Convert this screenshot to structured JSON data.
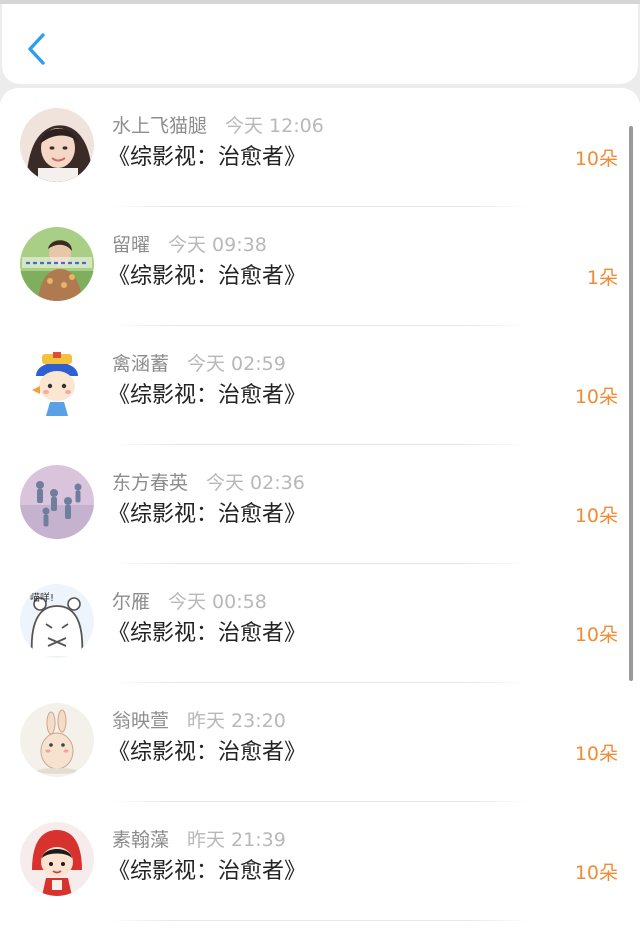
{
  "navbar": {
    "back_icon": "chevron-left-icon",
    "accent_color": "#2d9df0"
  },
  "list": {
    "count_color": "#f08c36",
    "items": [
      {
        "name": "水上飞猫腿",
        "time": "今天 12:06",
        "title": "《综影视：治愈者》",
        "count": "10朵",
        "avatar": "photo-woman-avatar"
      },
      {
        "name": "留曜",
        "time": "今天 09:38",
        "title": "《综影视：治愈者》",
        "count": "1朵",
        "avatar": "photo-man-avatar"
      },
      {
        "name": "禽涵蓄",
        "time": "今天 02:59",
        "title": "《综影视：治愈者》",
        "count": "10朵",
        "avatar": "cartoon-character-avatar"
      },
      {
        "name": "东方春英",
        "time": "今天 02:36",
        "title": "《综影视：治愈者》",
        "count": "10朵",
        "avatar": "photo-group-avatar"
      },
      {
        "name": "尔雁",
        "time": "今天 00:58",
        "title": "《综影视：治愈者》",
        "count": "10朵",
        "avatar": "cartoon-bear-avatar",
        "avatar_text": "喵咩!"
      },
      {
        "name": "翁映萱",
        "time": "昨天 23:20",
        "title": "《综影视：治愈者》",
        "count": "10朵",
        "avatar": "cartoon-rabbit-avatar"
      },
      {
        "name": "素翰藻",
        "time": "昨天 21:39",
        "title": "《综影视：治愈者》",
        "count": "10朵",
        "avatar": "cartoon-girl-avatar"
      }
    ]
  }
}
